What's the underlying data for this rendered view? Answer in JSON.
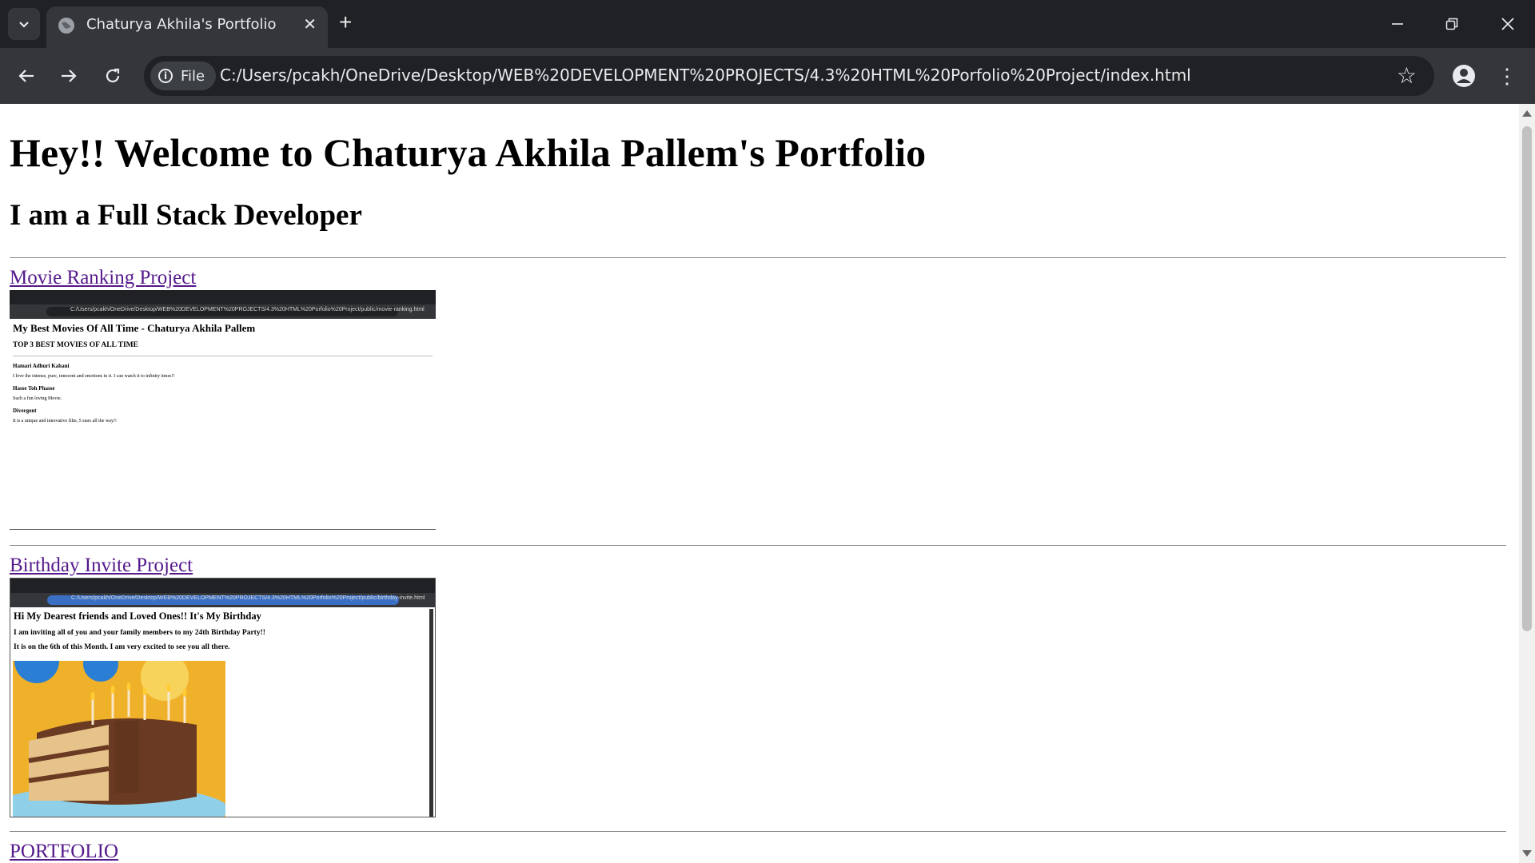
{
  "browser": {
    "tab_title": "Chaturya Akhila's Portfolio",
    "chip_label": "File",
    "url": "C:/Users/pcakh/OneDrive/Desktop/WEB%20DEVELOPMENT%20PROJECTS/4.3%20HTML%20Porfolio%20Project/index.html"
  },
  "page": {
    "heading": "Hey!! Welcome to Chaturya Akhila Pallem's Portfolio",
    "subheading": "I am a Full Stack Developer",
    "projects": [
      {
        "link": "Movie Ranking Project",
        "thumbnail": {
          "url": "C:/Users/pcakh/OneDrive/Desktop/WEB%20DEVELOPMENT%20PROJECTS/4.3%20HTML%20Porfolio%20Project/public/movie-ranking.html",
          "title": "My Best Movies Of All Time - Chaturya Akhila Pallem",
          "subtitle": "TOP 3 BEST MOVIES OF ALL TIME",
          "items": [
            {
              "name": "Hamari Adhuri Kahani",
              "desc": "I love the intense, pure, innocent and emotions in it. I can watch it to infinity times!!"
            },
            {
              "name": "Hasse Toh Phasse",
              "desc": "Such a fun loving Movie."
            },
            {
              "name": "Divergent",
              "desc": "It is a unique and innovative film, 5 stars all the way!!"
            }
          ]
        }
      },
      {
        "link": "Birthday Invite Project",
        "thumbnail": {
          "url": "C:/Users/pcakh/OneDrive/Desktop/WEB%20DEVELOPMENT%20PROJECTS/4.3%20HTML%20Porfolio%20Project/public/birthday-invite.html",
          "title": "Hi My Dearest friends and Loved Ones!! It's My Birthday",
          "line1": "I am inviting all of you and your family members to my 24th Birthday Party!!",
          "line2": "It is on the 6th of this Month. I am very excited to see you all there."
        }
      }
    ],
    "portfolio_link": "PORTFOLIO"
  }
}
